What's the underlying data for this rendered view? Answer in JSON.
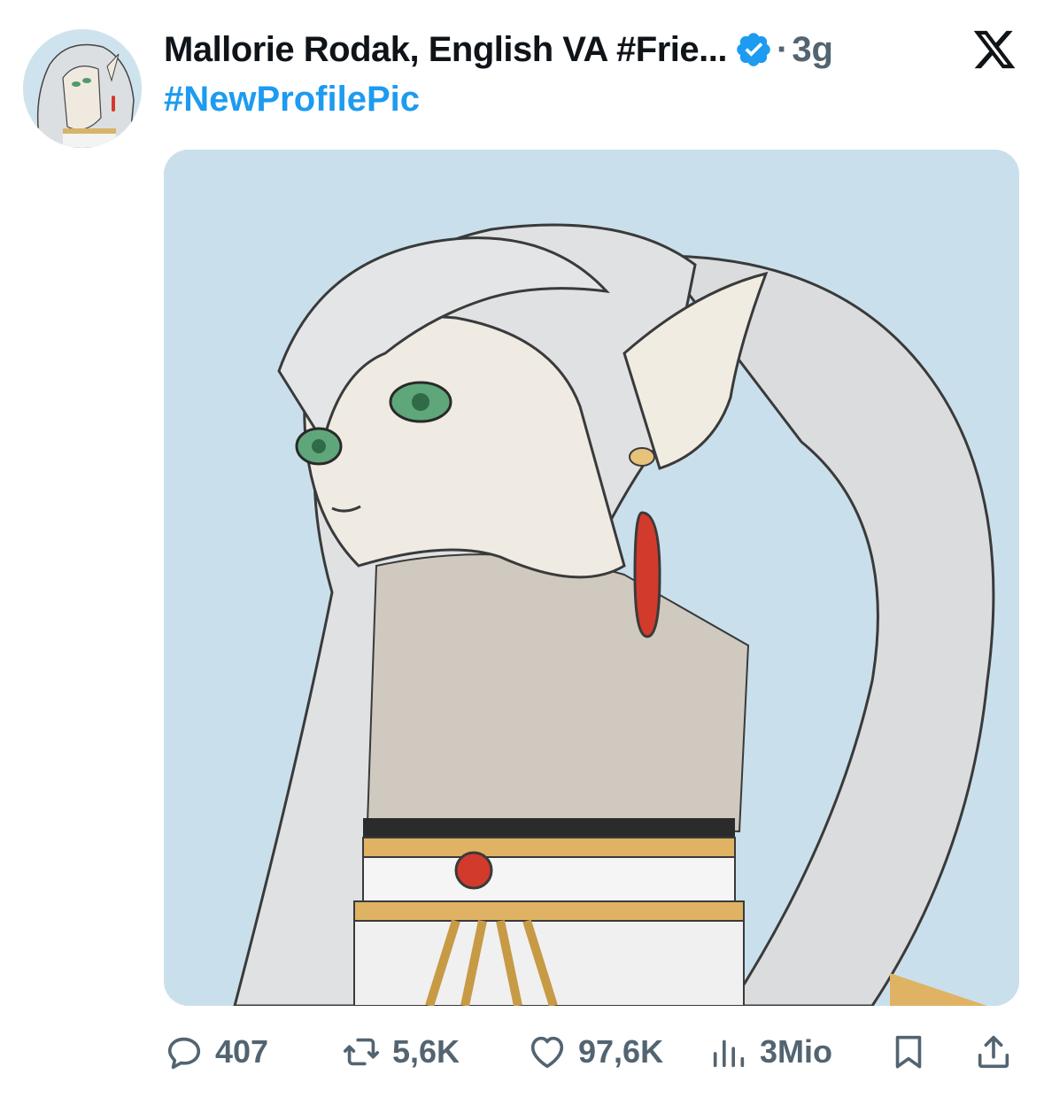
{
  "tweet": {
    "author_name": "Mallorie Rodak, English VA #Frie...",
    "dot": "·",
    "time": "3g",
    "text": "#NewProfilePic"
  },
  "icons": {
    "verified": "verified-badge-icon",
    "platform": "x-logo-icon",
    "reply": "reply-icon",
    "retweet": "retweet-icon",
    "like": "heart-icon",
    "views": "views-chart-icon",
    "bookmark": "bookmark-icon",
    "share": "share-icon"
  },
  "actions": {
    "replies": "407",
    "retweets": "5,6K",
    "likes": "97,6K",
    "views": "3Mio"
  },
  "colors": {
    "accent": "#1d9bf0",
    "muted": "#536471",
    "media_bg": "#c9e0ec"
  }
}
